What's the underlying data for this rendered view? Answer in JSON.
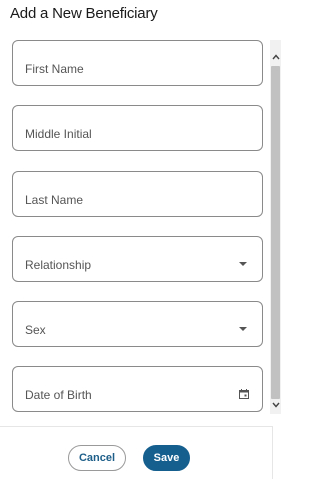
{
  "dialog": {
    "title": "Add a New Beneficiary"
  },
  "fields": [
    {
      "label": "First Name",
      "kind": "text"
    },
    {
      "label": "Middle Initial",
      "kind": "text"
    },
    {
      "label": "Last Name",
      "kind": "text"
    },
    {
      "label": "Relationship",
      "kind": "select",
      "icon": "caret-down-icon"
    },
    {
      "label": "Sex",
      "kind": "select",
      "icon": "caret-down-icon"
    },
    {
      "label": "Date of Birth",
      "kind": "date",
      "icon": "calendar-icon"
    }
  ],
  "actions": {
    "cancel_label": "Cancel",
    "save_label": "Save"
  },
  "colors": {
    "primary": "#155f8f",
    "field_border": "#8a8a8a",
    "scrollbar_thumb": "#c1c1c1"
  }
}
